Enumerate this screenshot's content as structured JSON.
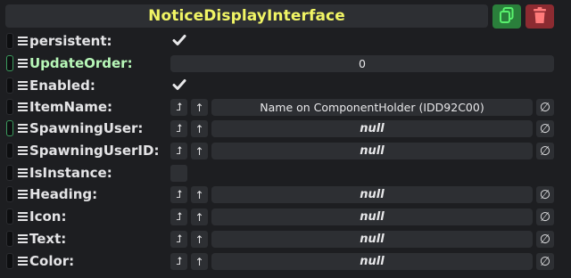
{
  "header": {
    "title": "NoticeDisplayInterface",
    "colors": {
      "title": "#f1f565",
      "copy": "#2a7f3b",
      "delete": "#8c2b31"
    }
  },
  "rows": [
    {
      "label": "persistent:",
      "kind": "checkbox",
      "checked": true
    },
    {
      "label": "UpdateOrder:",
      "kind": "number",
      "value": "0",
      "highlight": true
    },
    {
      "label": "Enabled:",
      "kind": "checkbox",
      "checked": true
    },
    {
      "label": "ItemName:",
      "kind": "ref",
      "value": "Name on ComponentHolder (IDD92C00)"
    },
    {
      "label": "SpawningUser:",
      "kind": "ref",
      "value": "null",
      "handleHighlight": true
    },
    {
      "label": "SpawningUserID:",
      "kind": "ref",
      "value": "null"
    },
    {
      "label": "IsInstance:",
      "kind": "checkbox",
      "checked": false
    },
    {
      "label": "Heading:",
      "kind": "ref",
      "value": "null"
    },
    {
      "label": "Icon:",
      "kind": "ref",
      "value": "null"
    },
    {
      "label": "Text:",
      "kind": "ref",
      "value": "null"
    },
    {
      "label": "Color:",
      "kind": "ref",
      "value": "null"
    }
  ],
  "icons": {
    "jump": "jump-to-source-icon",
    "up": "arrow-up-icon",
    "clear": "null-set-icon",
    "copy": "copy-icon",
    "delete": "trash-icon",
    "menu": "hamburger-menu-icon",
    "check": "checkmark-icon"
  },
  "glyphs": {
    "jump": "⮥",
    "up": "↑",
    "clear": "∅"
  }
}
